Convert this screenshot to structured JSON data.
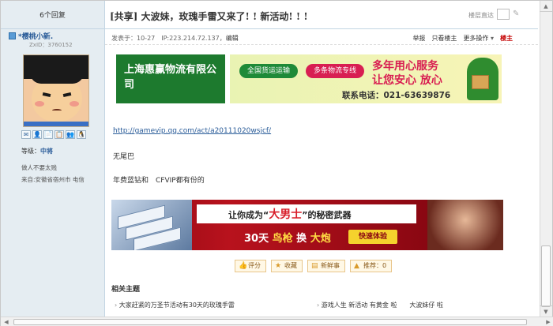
{
  "left": {
    "reply_count": "6个回复",
    "username": "*樱桃小新.",
    "zxid": "ZxID：3760152",
    "level_label": "等级：",
    "level_value": "中将",
    "signature": "做人不要太贱",
    "origin": "来自:安徽省宿州市 电信",
    "tool_icons": [
      "✉",
      "👤",
      "📄",
      "📋",
      "👥",
      "🐧"
    ]
  },
  "header": {
    "title": "[共享] 大波妹，玫瑰手雷又来了! ! 新活动! ! !",
    "jump_label": "楼层直达"
  },
  "meta": {
    "post_info": "发表于：10-27　IP:223.214.72.137，",
    "edit": "编辑",
    "report": "举报",
    "only_op": "只看楼主",
    "more": "更多操作",
    "floor": "楼主"
  },
  "ad_top": {
    "company": "上海惠赢物流有限公司",
    "pill1": "全国货运运输",
    "pill2": "多条物流专线",
    "slogan1": "多年用心服务",
    "slogan2": "让您安心 放心",
    "phone": "联系电话：021-63639876"
  },
  "post": {
    "link": "http://gamevip.qq.com/act/a20111020wsjcf/",
    "line1": "无尾巴",
    "line2": "年费蓝钻和　CFVIP都有份的"
  },
  "ad_bottom": {
    "headline_pre": "让你成为“",
    "headline_hl": "大男士",
    "headline_post": "”的秘密武器",
    "sub_pre": "30天 ",
    "sub_b1": "鸟枪",
    "sub_mid": " 换 ",
    "sub_b2": "大炮",
    "button": "快速体验"
  },
  "rate_buttons": [
    {
      "label": "评分",
      "icon": "thumb-icon"
    },
    {
      "label": "收藏",
      "icon": "star-icon"
    },
    {
      "label": "新鲜事",
      "icon": "news-icon"
    },
    {
      "label": "推荐：0",
      "icon": "recommend-icon"
    }
  ],
  "related": {
    "title": "相关主题",
    "items": [
      "大家赶紧的万圣节活动有30天的玫瑰手雷",
      "游戏人生 新活动 有黄金 啦　　大波妹仔 啦"
    ]
  }
}
